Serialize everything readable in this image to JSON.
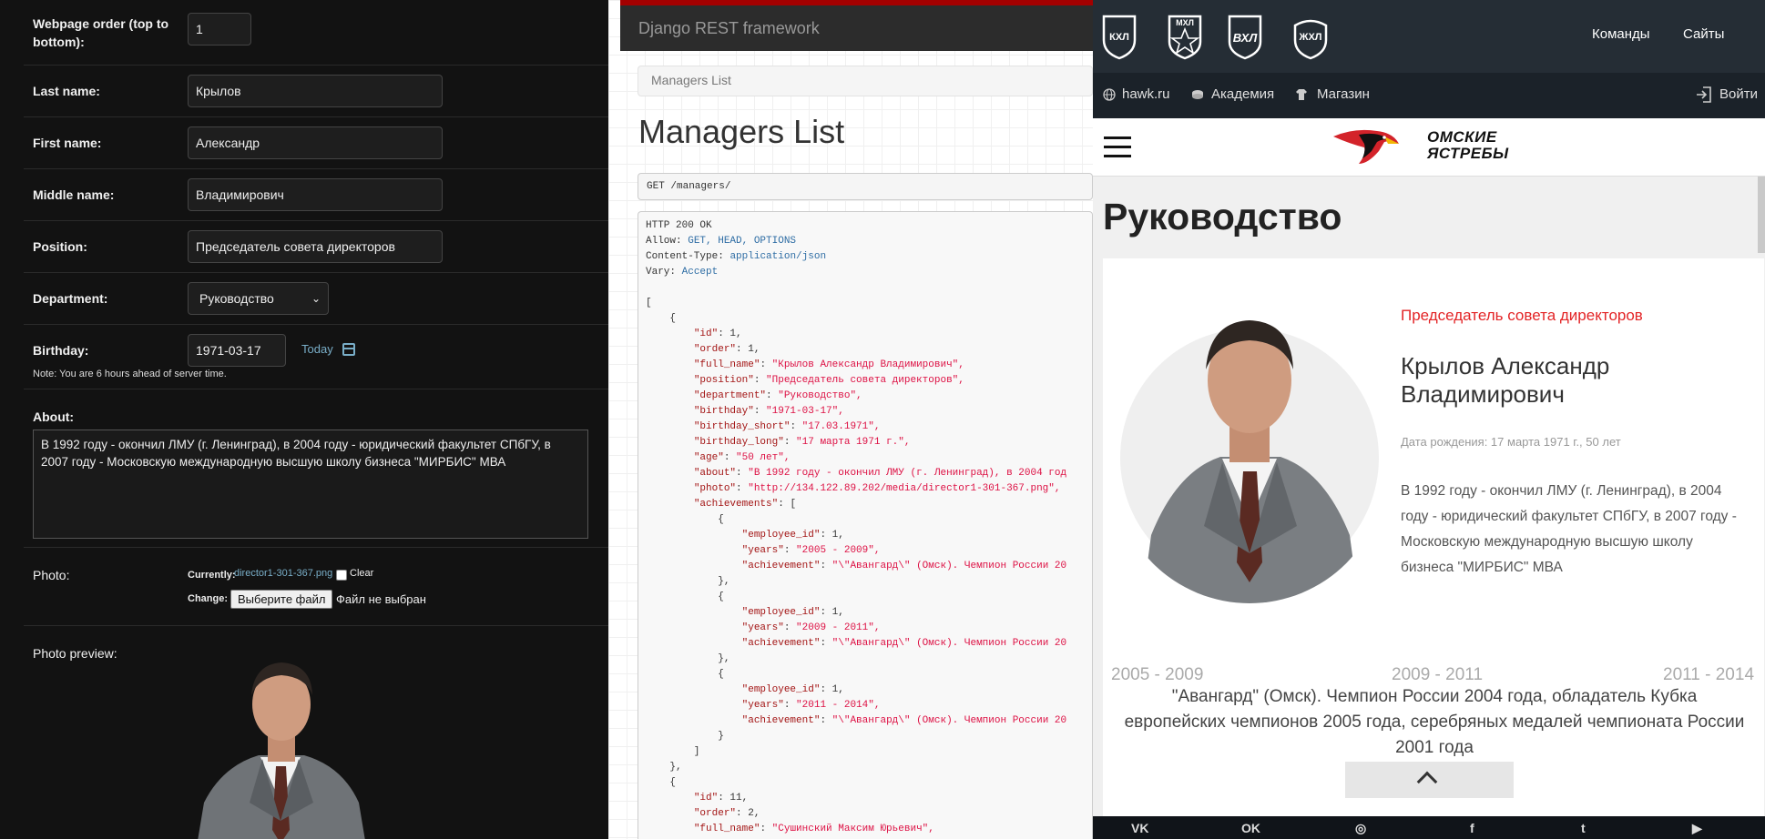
{
  "admin": {
    "webpage_order_label": "Webpage order (top to bottom):",
    "webpage_order_value": "1",
    "last_name_label": "Last name:",
    "last_name_value": "Крылов",
    "first_name_label": "First name:",
    "first_name_value": "Александр",
    "middle_name_label": "Middle name:",
    "middle_name_value": "Владимирович",
    "position_label": "Position:",
    "position_value": "Председатель совета директоров",
    "department_label": "Department:",
    "department_value": "Руководство",
    "birthday_label": "Birthday:",
    "birthday_value": "1971-03-17",
    "today_link": "Today",
    "timezone_note": "Note: You are 6 hours ahead of server time.",
    "about_label": "About:",
    "about_value": "В 1992 году - окончил ЛМУ (г. Ленинград), в 2004 году - юридический факультет СПбГУ, в 2007 году - Московскую международную высшую школу бизнеса \"МИРБИС\" МВА",
    "photo_label": "Photo:",
    "currently_label": "Currently:",
    "currently_file": "director1-301-367.png",
    "clear_label": "Clear",
    "change_label": "Change:",
    "file_button": "Выберите файл",
    "no_file": "Файл не выбран",
    "photo_preview_label": "Photo preview:"
  },
  "drf": {
    "brand": "Django REST framework",
    "breadcrumb": "Managers List",
    "title": "Managers List",
    "request": "GET /managers/",
    "status": "HTTP 200 OK",
    "allow_key": "Allow:",
    "allow_value": "GET, HEAD, OPTIONS",
    "content_type_key": "Content-Type:",
    "content_type_value": "application/json",
    "vary_key": "Vary:",
    "vary_value": "Accept",
    "json_lines": [
      "[",
      "    {",
      "        \"id\": 1,",
      "        \"order\": 1,",
      "        \"full_name\": \"Крылов Александр Владимирович\",",
      "        \"position\": \"Председатель совета директоров\",",
      "        \"department\": \"Руководство\",",
      "        \"birthday\": \"1971-03-17\",",
      "        \"birthday_short\": \"17.03.1971\",",
      "        \"birthday_long\": \"17 марта 1971 г.\",",
      "        \"age\": \"50 лет\",",
      "        \"about\": \"В 1992 году - окончил ЛМУ (г. Ленинград), в 2004 год",
      "        \"photo\": \"http://134.122.89.202/media/director1-301-367.png\",",
      "        \"achievements\": [",
      "            {",
      "                \"employee_id\": 1,",
      "                \"years\": \"2005 - 2009\",",
      "                \"achievement\": \"\\\"Авангард\\\" (Омск). Чемпион России 20",
      "            },",
      "            {",
      "                \"employee_id\": 1,",
      "                \"years\": \"2009 - 2011\",",
      "                \"achievement\": \"\\\"Авангард\\\" (Омск). Чемпион России 20",
      "            },",
      "            {",
      "                \"employee_id\": 1,",
      "                \"years\": \"2011 - 2014\",",
      "                \"achievement\": \"\\\"Авангард\\\" (Омск). Чемпион России 20",
      "            }",
      "        ]",
      "    },",
      "    {",
      "        \"id\": 11,",
      "        \"order\": 2,",
      "        \"full_name\": \"Сушинский Максим Юрьевич\","
    ]
  },
  "hawk": {
    "leagues": [
      "КХЛ",
      "МХЛ",
      "ВХЛ",
      "ЖХЛ"
    ],
    "nav_teams": "Команды",
    "nav_sites": "Сайты",
    "sub_site": "hawk.ru",
    "sub_academy": "Академия",
    "sub_shop": "Магазин",
    "login": "Войти",
    "logo_line1": "ОМСКИЕ",
    "logo_line2": "ЯСТРЕБЫ",
    "page_title": "Руководство",
    "position": "Председатель совета директоров",
    "name": "Крылов Александр Владимирович",
    "birthday": "Дата рождения: 17 марта 1971 г., 50 лет",
    "bio": "В 1992 году - окончил ЛМУ (г. Ленинград), в 2004 году - юридический факультет СПбГУ, в 2007 году - Московскую международную высшую школу бизнеса \"МИРБИС\" МВА",
    "years": [
      "2005 - 2009",
      "2009 - 2011",
      "2011 - 2014"
    ],
    "achievement": "\"Авангард\" (Омск). Чемпион России 2004 года, обладатель Кубка европейских чемпионов 2005 года, серебряных медалей чемпионата России 2001 года",
    "social": [
      "vk",
      "ok",
      "instagram",
      "facebook",
      "twitter",
      "youtube"
    ],
    "social_glyphs": [
      "VK",
      "OK",
      "◎",
      "f",
      "t",
      "▶"
    ],
    "accent_color": "#e32426"
  }
}
